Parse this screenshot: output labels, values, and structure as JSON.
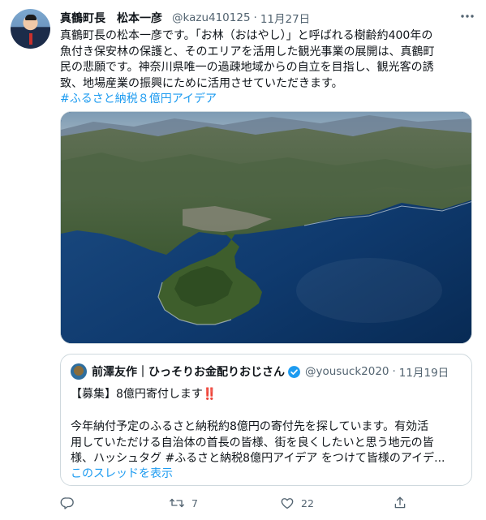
{
  "tweet": {
    "display_name": "真鶴町長　松本一彦",
    "handle": "@kazu410125",
    "separator": "·",
    "timestamp": "11月27日",
    "more_icon": "more-horizontal-icon",
    "text_lines": [
      "真鶴町長の松本一彦です。「お林（おはやし）」と呼ばれる樹齢約400年の",
      "魚付き保安林の保護と、そのエリアを活用した観光事業の展開は、真鶴町",
      "民の悲願です。神奈川県唯一の過疎地域からの自立を目指し、観光客の誘",
      "致、地場産業の振興にために活用させていただきます。"
    ],
    "hashtag": "#ふるさと納税８億円アイデア",
    "media": {
      "kind": "aerial photo of peninsula and sea"
    }
  },
  "quoted_tweet": {
    "display_name": "前澤友作｜ひっそりお金配りおじさん",
    "verified_icon": "verified-badge-icon",
    "handle": "@yousuck2020",
    "separator": "·",
    "timestamp": "11月19日",
    "line1_text": "【募集】8億円寄付します",
    "line1_emoji": "‼️",
    "body_lines": [
      "今年納付予定のふるさと納税約8億円の寄付先を探しています。有効活",
      "用していただける自治体の首長の皆様、街を良くしたいと思う地元の皆",
      "様、ハッシュタグ #ふるさと納税8億円アイデア をつけて皆様のアイデ..."
    ],
    "show_thread": "このスレッドを表示"
  },
  "actions": {
    "reply": {
      "icon": "reply-icon",
      "count": ""
    },
    "retweet": {
      "icon": "retweet-icon",
      "count": "7"
    },
    "like": {
      "icon": "heart-icon",
      "count": "22"
    },
    "share": {
      "icon": "share-icon",
      "count": ""
    }
  },
  "colors": {
    "accent": "#1d9bf0",
    "muted": "#536471",
    "text": "#0f1419",
    "border": "#cfd9de",
    "alert": "#c4232b"
  }
}
